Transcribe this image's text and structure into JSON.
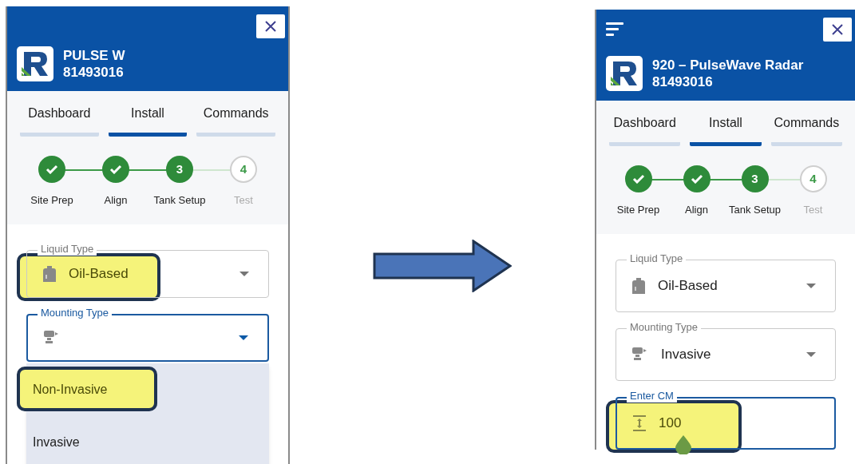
{
  "screens": [
    {
      "header": {
        "menu": false,
        "title": "PULSE W",
        "serial": "81493016"
      },
      "tabs": [
        {
          "label": "Dashboard",
          "selected": false
        },
        {
          "label": "Install",
          "selected": true
        },
        {
          "label": "Commands",
          "selected": false
        }
      ],
      "steps": [
        {
          "label": "Site Prep",
          "kind": "done"
        },
        {
          "label": "Align",
          "kind": "done"
        },
        {
          "label": "Tank Setup",
          "kind": "current",
          "number": "3"
        },
        {
          "label": "Test",
          "kind": "pending",
          "number": "4"
        }
      ],
      "fields": [
        {
          "kind": "select",
          "label": "Liquid Type",
          "value": "Oil-Based",
          "focused": false,
          "highlighted": true
        },
        {
          "kind": "select",
          "label": "Mounting Type",
          "focused": true,
          "highlighted": false
        }
      ],
      "menu": {
        "options": [
          {
            "label": "Non-Invasive",
            "highlighted": true
          },
          {
            "label": "Invasive",
            "highlighted": false
          }
        ]
      }
    },
    {
      "header": {
        "menu": true,
        "title": "920 – PulseWave Radar",
        "serial": "81493016"
      },
      "tabs": [
        {
          "label": "Dashboard",
          "selected": false
        },
        {
          "label": "Install",
          "selected": true
        },
        {
          "label": "Commands",
          "selected": false
        }
      ],
      "steps": [
        {
          "label": "Site Prep",
          "kind": "done"
        },
        {
          "label": "Align",
          "kind": "done"
        },
        {
          "label": "Tank Setup",
          "kind": "current",
          "number": "3"
        },
        {
          "label": "Test",
          "kind": "pending",
          "number": "4"
        }
      ],
      "fields": [
        {
          "kind": "select",
          "label": "Liquid Type",
          "value": "Oil-Based",
          "focused": false,
          "highlighted": false
        },
        {
          "kind": "select",
          "label": "Mounting Type",
          "value": "Invasive",
          "focused": false,
          "highlighted": false
        },
        {
          "kind": "input",
          "label": "Enter CM",
          "value": "100",
          "focused": true,
          "highlighted": true
        }
      ]
    }
  ]
}
